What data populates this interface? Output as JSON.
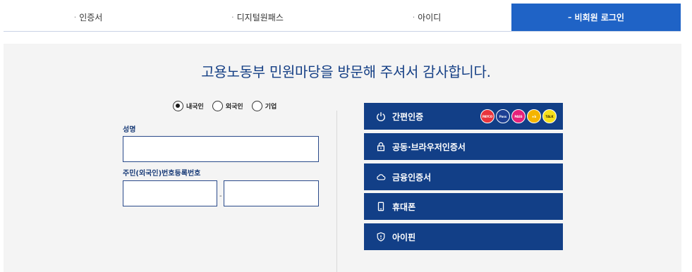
{
  "tabs": [
    {
      "label": "인증서",
      "marker": "·",
      "active": false
    },
    {
      "label": "디지털원패스",
      "marker": "·",
      "active": false
    },
    {
      "label": "아이디",
      "marker": "·",
      "active": false
    },
    {
      "label": "비회원 로그인",
      "marker": "–",
      "active": true
    }
  ],
  "headline": "고용노동부 민원마당을 방문해 주셔서 감사합니다.",
  "user_type": {
    "options": [
      "내국인",
      "외국인",
      "기업"
    ],
    "selected": "내국인"
  },
  "form": {
    "name_label": "성명",
    "name_value": "",
    "rrn_label": "주민(외국인)번호등록번호",
    "rrn_front_value": "",
    "rrn_back_value": "",
    "rrn_separator": "-"
  },
  "auth_buttons": [
    {
      "label": "간편인증",
      "icon": "power-icon"
    },
    {
      "label": "공동·브라우저인증서",
      "icon": "lock-icon"
    },
    {
      "label": "금융인증서",
      "icon": "cloud-icon"
    },
    {
      "label": "휴대폰",
      "icon": "phone-icon"
    },
    {
      "label": "아이핀",
      "icon": "shield-icon"
    }
  ],
  "brands": [
    {
      "name": "payco-logo",
      "text": "PAYCO",
      "color": "#e8343c"
    },
    {
      "name": "samsung-pass-logo",
      "text": "Pass",
      "color": "#1c3f94"
    },
    {
      "name": "pass-logo",
      "text": "PASS",
      "color": "#e6217a"
    },
    {
      "name": "kb-logo",
      "text": "★b",
      "color": "#f4b400"
    },
    {
      "name": "kakao-logo",
      "text": "TALK",
      "color": "#f7e01b"
    }
  ]
}
